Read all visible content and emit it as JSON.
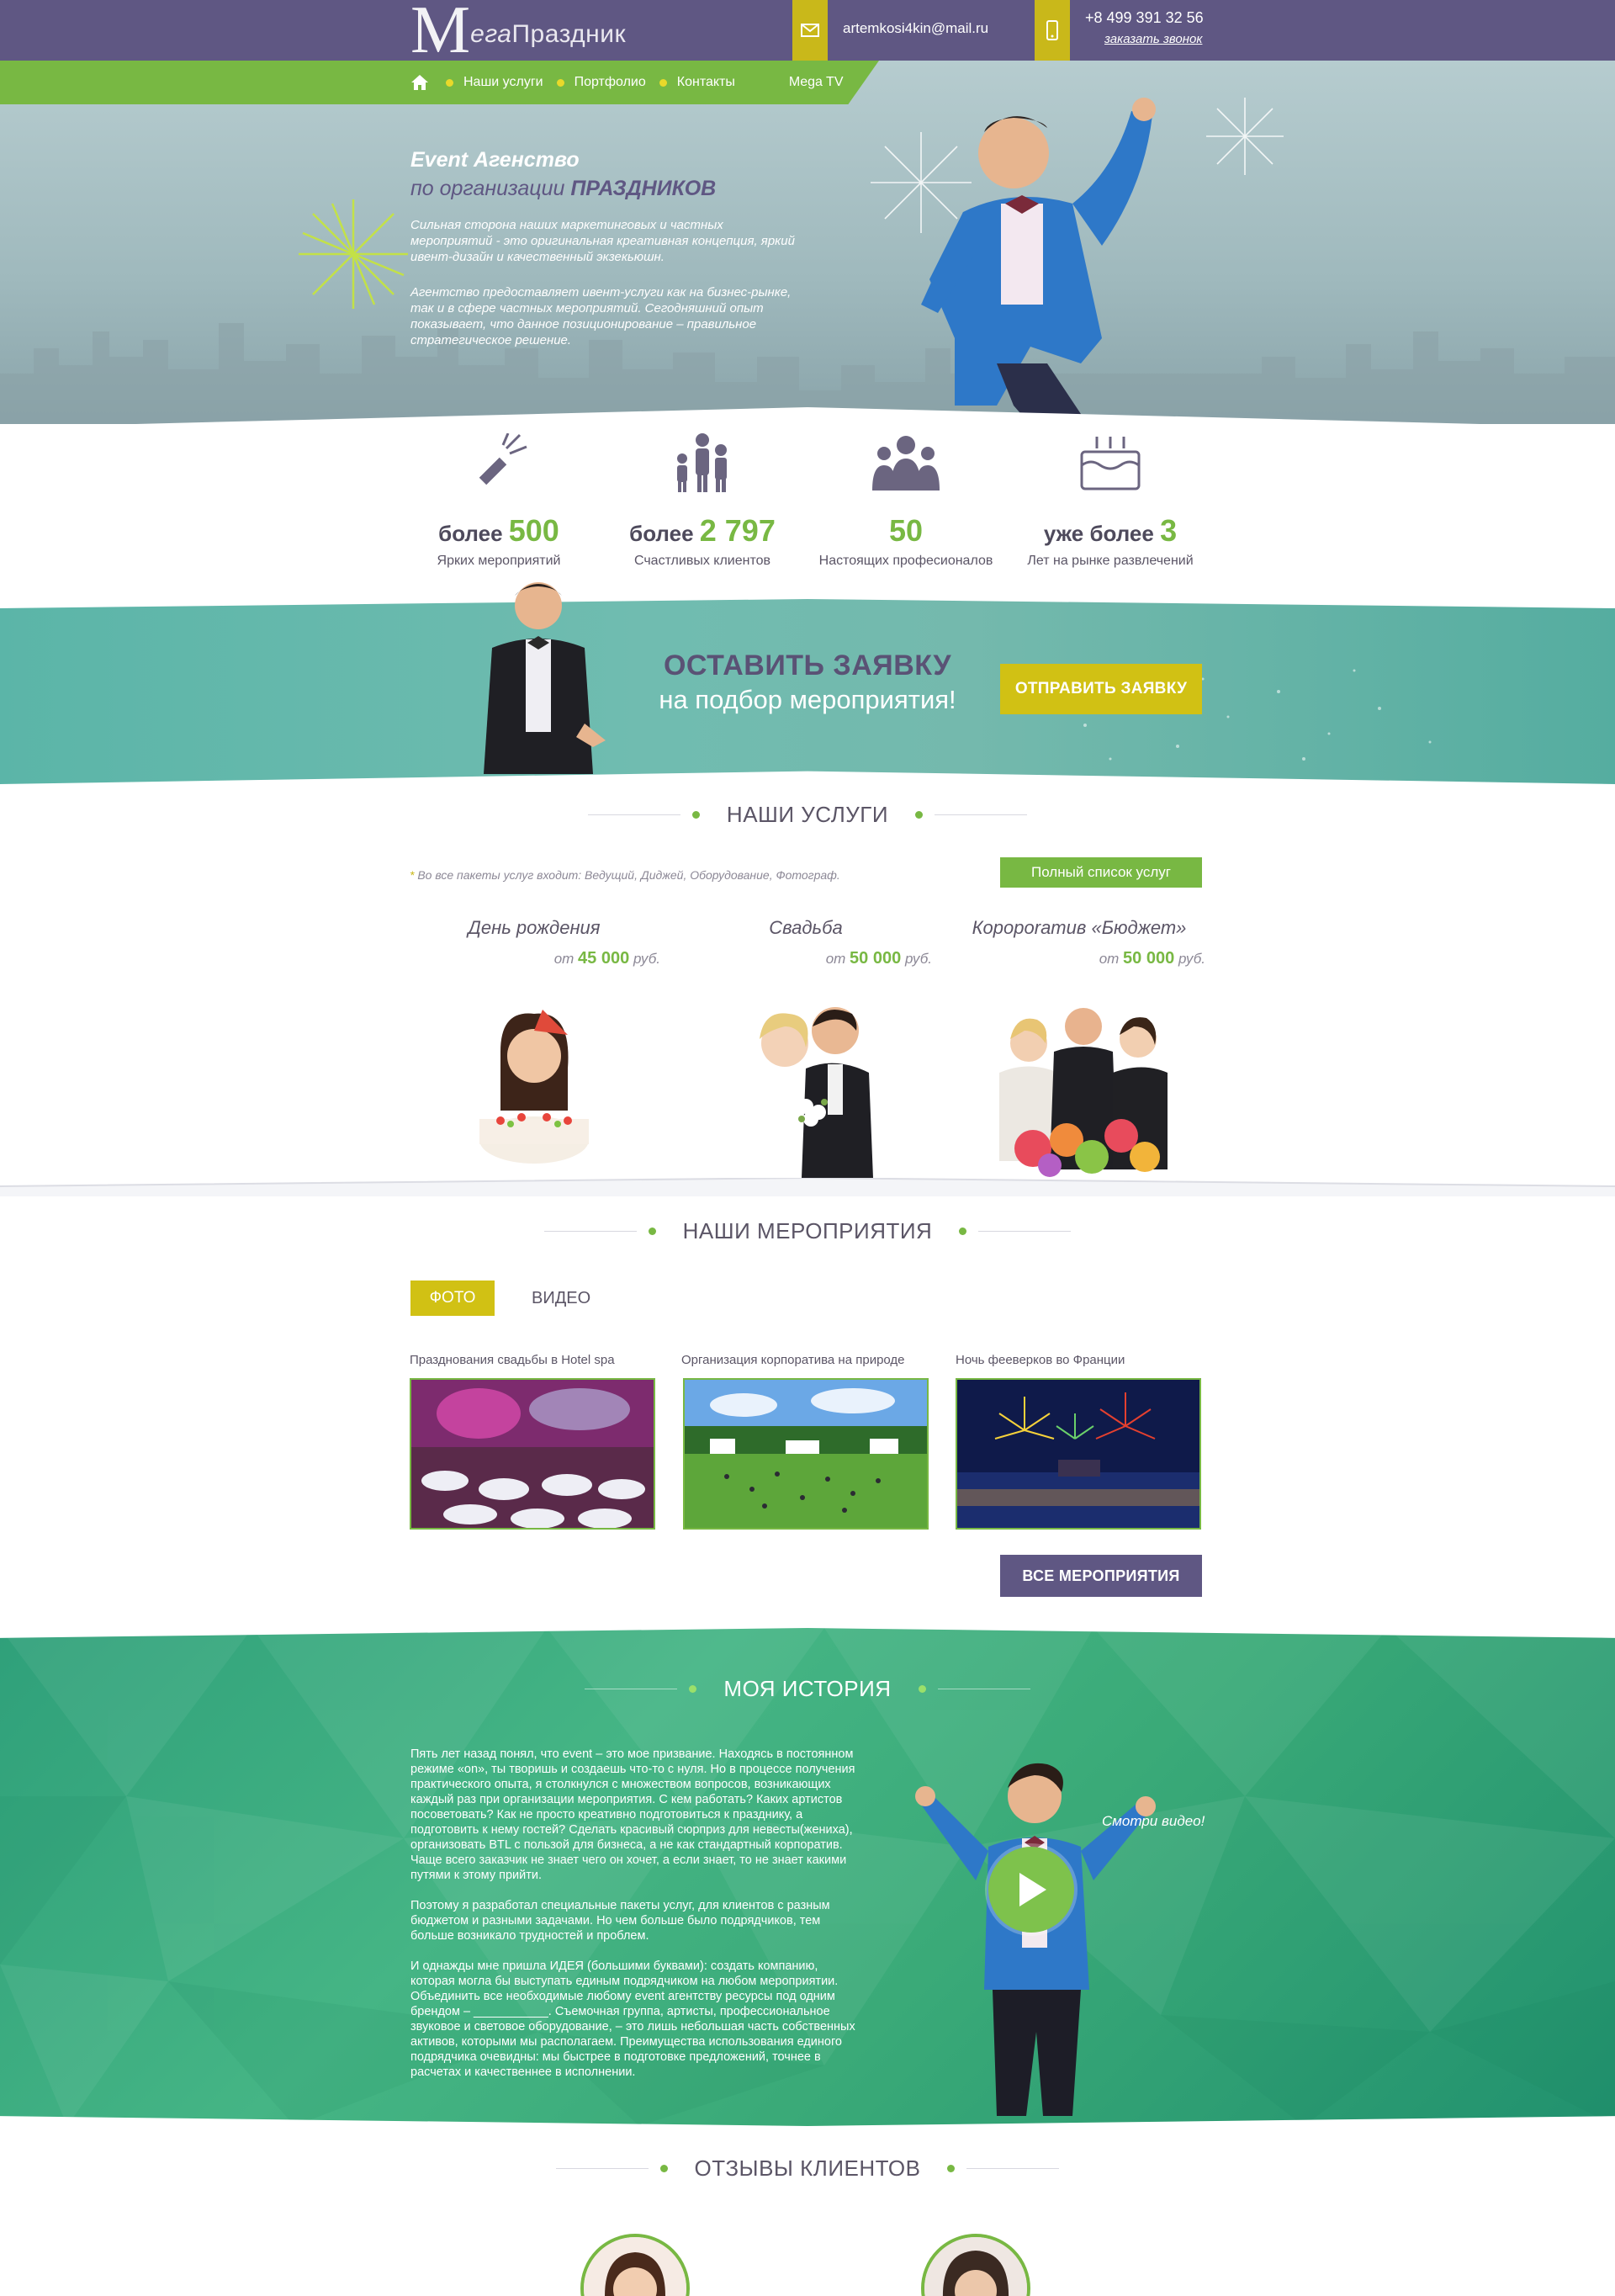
{
  "header": {
    "logo_m": "M",
    "logo_italic": "ега",
    "logo_rest": "Праздник",
    "email": "artemkosi4kin@mail.ru",
    "phone": "+8 499 391 32 56",
    "callback": "заказать звонок"
  },
  "nav": {
    "items": [
      {
        "label": "Наши услуги"
      },
      {
        "label": "Портфолио"
      },
      {
        "label": "Контакты"
      }
    ],
    "tv": "Mega TV"
  },
  "hero": {
    "title_line1": "Event Агенство",
    "title_line2_prefix": "по организации ",
    "title_line2_bold": "ПРАЗДНИКОВ",
    "p1": "Сильная сторона наших маркетинговых и частных мероприятий - это оригинальная креативная концепция, яркий ивент-дизайн и качественный экзекьюшн.",
    "p2": "Агентство предоставляет ивент-услуги как на бизнес-рынке, так и в сфере частных мероприятий. Сегодняшний опыт показывает, что данное позиционирование – правильное стратегическое решение."
  },
  "stats": [
    {
      "prefix": "более ",
      "number": "500",
      "caption": "Ярких мероприятий",
      "icon": "firework-rocket-icon"
    },
    {
      "prefix": "более ",
      "number": "2 797",
      "caption": "Счастливых клиентов",
      "icon": "family-icon"
    },
    {
      "prefix": "",
      "number": "50",
      "caption": "Настоящих професионалов",
      "icon": "team-icon"
    },
    {
      "prefix": "уже более ",
      "number": "3",
      "caption": "Лет на рынке развлечений",
      "icon": "cake-icon"
    }
  ],
  "request": {
    "title": "ОСТАВИТЬ ЗАЯВКУ",
    "subtitle": "на подбор мероприятия!",
    "button": "ОТПРАВИТЬ ЗАЯВКУ"
  },
  "services": {
    "title": "НАШИ УСЛУГИ",
    "included": "Во все пакеты услуг входит:  Ведущий, Диджей, Оборудование, Фотограф.",
    "full_list": "Полный список услуг",
    "items": [
      {
        "name": "День рождения",
        "price_prefix": "от ",
        "price": "45 000",
        "currency": " руб."
      },
      {
        "name": "Свадьба",
        "price_prefix": "от ",
        "price": "50 000",
        "currency": " руб."
      },
      {
        "name": "Короporатив «Бюджет»",
        "price_prefix": "от ",
        "price": "50 000",
        "currency": " руб."
      }
    ]
  },
  "events": {
    "title": "НАШИ МЕРОПРИЯТИЯ",
    "tab_photo": "ФОТО",
    "tab_video": "ВИДЕО",
    "items": [
      {
        "caption": "Празднования свадьбы в Hotel spa"
      },
      {
        "caption": "Организация корпоратива на природе"
      },
      {
        "caption": "Ночь фееверков во Франции"
      }
    ],
    "all_button": "ВСЕ МЕРОПРИЯТИЯ"
  },
  "history": {
    "title": "МОЯ ИСТОРИЯ",
    "text": "Пять лет назад понял, что event  – это мое призвание. Находясь в постоянном режиме «on», ты творишь и создаешь что-то с нуля.  Но в процессе получения практического опыта, я столкнулся с множеством вопросов, возникающих каждый раз при организации мероприятия. С кем работать? Каких артистов посоветовать? Как не просто креативно подготовиться к празднику, а подготовить к нему гостей? Сделать красивый сюрприз для невесты(жениха), организовать BTL с пользой для бизнеса, а не как стандартный корпоратив. Чаще всего заказчик не знает чего он хочет, а если знает, то не знает какими путями к этому прийти.\n\n Поэтому я разработал специальные пакеты услуг, для клиентов с разным бюджетом и разными задачами.  Но чем больше было подрядчиков, тем больше возникало трудностей и проблем.\n\n И однажды мне пришла ИДЕЯ (большими буквами): создать компанию, которая могла бы выступать единым подрядчиком на любом мероприятии. Объединить все необходимые любому event агентству ресурсы под одним брендом – ___________.  Съемочная группа, артисты, профессиональное звуковое и световое оборудование, – это лишь небольшая часть собственных активов, которыми мы располагаем. Преимущества использования единого подрядчика очевидны: мы быстрее в подготовке предложений, точнее в расчетах и качественнее в исполнении.",
    "watch": "Смотри видео!"
  },
  "reviews": {
    "title": "ОТЗЫВЫ КЛИЕНТОВ"
  },
  "colors": {
    "purple": "#5f5783",
    "green": "#78b843",
    "yellow": "#d1c114",
    "teal": "#5bb5a8",
    "emerald": "#3aaa78"
  }
}
